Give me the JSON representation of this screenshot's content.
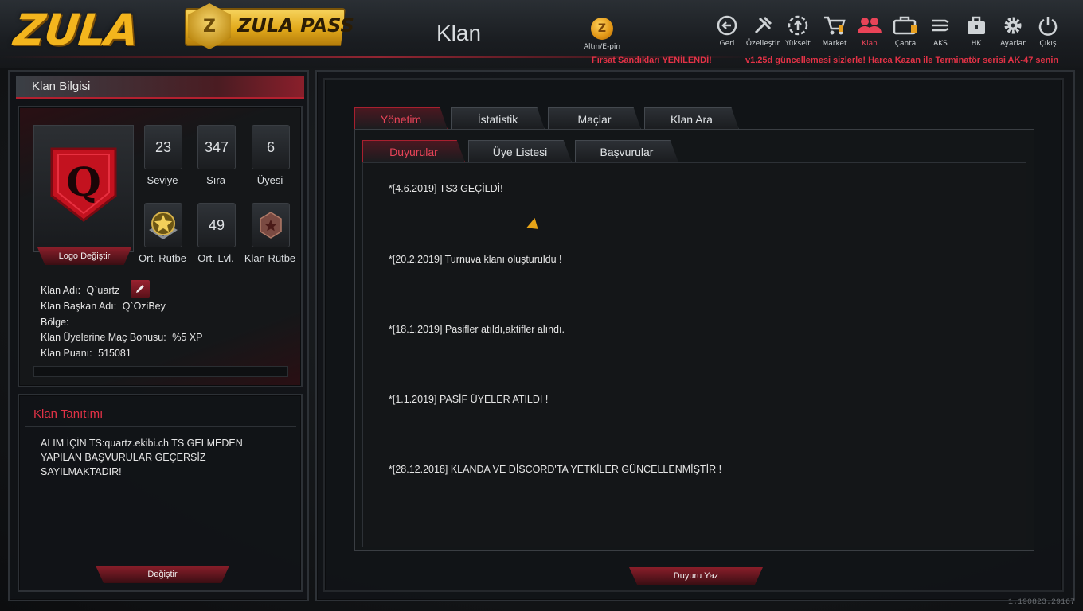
{
  "header": {
    "logo_text": "ZULA",
    "zula_pass": {
      "badge": "Z",
      "label": "ZULA PASS"
    },
    "page_title": "Klan",
    "epin": {
      "coin": "Z",
      "label": "Altın/E-pin"
    },
    "nav": [
      {
        "id": "geri",
        "label": "Geri",
        "icon": "back-arrow-icon"
      },
      {
        "id": "ozellestir",
        "label": "Özelleştir",
        "icon": "tools-icon"
      },
      {
        "id": "yukselt",
        "label": "Yükselt",
        "icon": "upgrade-icon"
      },
      {
        "id": "market",
        "label": "Market",
        "icon": "cart-icon"
      },
      {
        "id": "klan",
        "label": "Klan",
        "icon": "users-icon",
        "active": true
      },
      {
        "id": "canta",
        "label": "Çanta",
        "icon": "bag-icon"
      },
      {
        "id": "aks",
        "label": "AKS",
        "icon": "aks-icon"
      },
      {
        "id": "hk",
        "label": "HK",
        "icon": "briefcase-icon"
      },
      {
        "id": "ayarlar",
        "label": "Ayarlar",
        "icon": "gear-icon"
      },
      {
        "id": "cikis",
        "label": "Çıkış",
        "icon": "power-icon"
      }
    ],
    "ticker_1": "Fırsat Sandıkları YENİLENDİ!",
    "ticker_2": "v1.25d güncellemesi sizlerle! Harca Kazan ile Terminatör serisi AK-47 senin"
  },
  "left": {
    "header": "Klan Bilgisi",
    "logo_change": "Logo Değiştir",
    "stats": [
      {
        "value": "23",
        "label": "Seviye"
      },
      {
        "value": "347",
        "label": "Sıra"
      },
      {
        "value": "6",
        "label": "Üyesi"
      },
      {
        "value": "",
        "label": "Ort. Rütbe",
        "icon": "star-rank-icon"
      },
      {
        "value": "49",
        "label": "Ort. Lvl."
      },
      {
        "value": "",
        "label": "Klan Rütbe",
        "icon": "clan-rank-icon"
      }
    ],
    "info": {
      "klan_adi_label": "Klan Adı:",
      "klan_adi": "Q`uartz",
      "baskan_label": "Klan Başkan Adı:",
      "baskan": "Q`OziBey",
      "bolge_label": "Bölge:",
      "bonus_label": "Klan Üyelerine Maç Bonusu:",
      "bonus": "%5 XP",
      "puan_label": "Klan Puanı:",
      "puan": "515081"
    },
    "tanitim_title": "Klan Tanıtımı",
    "tanitim_text": "ALIM İÇİN TS:quartz.ekibi.ch TS GELMEDEN YAPILAN BAŞVURULAR GEÇERSİZ SAYILMAKTADIR!",
    "degistir": "Değiştir"
  },
  "right": {
    "tabs": [
      "Yönetim",
      "İstatistik",
      "Maçlar",
      "Klan Ara"
    ],
    "subtabs": [
      "Duyurular",
      "Üye Listesi",
      "Başvurular"
    ],
    "announcements": [
      "*[4.6.2019] TS3 GEÇİLDİ!",
      "*[20.2.2019] Turnuva klanı oluşturuldu !",
      "*[18.1.2019] Pasifler atıldı,aktifler alındı.",
      "*[1.1.2019] PASİF ÜYELER ATILDI !",
      "*[28.12.2018] KLANDA VE DİSCORD'TA YETKİLER GÜNCELLENMİŞTİR !"
    ],
    "duyuru_yaz": "Duyuru Yaz"
  },
  "version": "1.190823.29167",
  "colors": {
    "accent": "#e23246",
    "gold": "#f3b51d",
    "panel": "#151719"
  }
}
